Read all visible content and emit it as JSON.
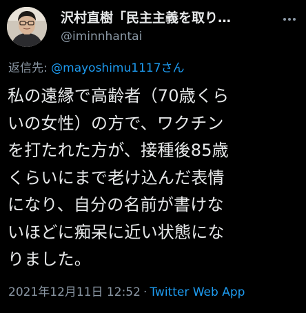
{
  "author": {
    "display_name": "沢村直樹「民主主義を取り…",
    "handle": "@iminnhantai"
  },
  "reply": {
    "label": "返信先:",
    "to": "@mayoshimu1117さん"
  },
  "tweet": {
    "lines": [
      "私の遠縁で高齢者（70歳くら",
      "いの女性）の方で、ワクチン",
      "を打たれた方が、接種後85歳",
      "くらいにまで老け込んだ表情",
      "になり、自分の名前が書けな",
      "いほどに痴呆に近い状態にな",
      "りました。"
    ]
  },
  "meta": {
    "timestamp": "2021年12月11日 12:52",
    "separator": "·",
    "source": "Twitter Web App"
  },
  "colors": {
    "background": "#000000",
    "text": "#e7e9ea",
    "secondary": "#8b98a5",
    "link": "#1d9bf0"
  },
  "icons": {
    "avatar": "person-photo",
    "more": "more-dots-icon"
  }
}
